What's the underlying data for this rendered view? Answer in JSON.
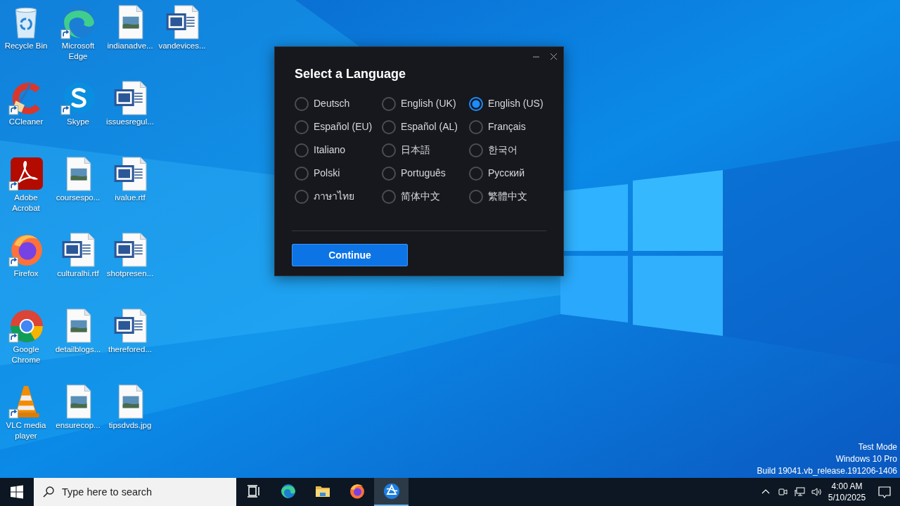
{
  "desktop": {
    "icons": [
      {
        "label": "Recycle Bin",
        "kind": "recycle-bin",
        "shortcut": false
      },
      {
        "label": "CCleaner",
        "kind": "ccleaner",
        "shortcut": true
      },
      {
        "label": "Adobe Acrobat",
        "kind": "acrobat",
        "shortcut": true
      },
      {
        "label": "Firefox",
        "kind": "firefox",
        "shortcut": true
      },
      {
        "label": "Google Chrome",
        "kind": "chrome",
        "shortcut": true
      },
      {
        "label": "VLC media player",
        "kind": "vlc",
        "shortcut": true
      },
      {
        "label": "Microsoft Edge",
        "kind": "edge",
        "shortcut": true
      },
      {
        "label": "Skype",
        "kind": "skype",
        "shortcut": true
      },
      {
        "label": "coursespo...",
        "kind": "image-file",
        "shortcut": false
      },
      {
        "label": "culturalhi.rtf",
        "kind": "word-file",
        "shortcut": false
      },
      {
        "label": "detailblogs...",
        "kind": "image-file",
        "shortcut": false
      },
      {
        "label": "ensurecop...",
        "kind": "image-file",
        "shortcut": false
      },
      {
        "label": "indianadve...",
        "kind": "image-file",
        "shortcut": false
      },
      {
        "label": "issuesregul...",
        "kind": "word-file",
        "shortcut": false
      },
      {
        "label": "ivalue.rtf",
        "kind": "word-file",
        "shortcut": false
      },
      {
        "label": "shotpresen...",
        "kind": "word-file",
        "shortcut": false
      },
      {
        "label": "therefored...",
        "kind": "word-file",
        "shortcut": false
      },
      {
        "label": "tipsdvds.jpg",
        "kind": "image-file",
        "shortcut": false
      },
      {
        "label": "vandevices...",
        "kind": "word-file",
        "shortcut": false
      }
    ],
    "system_notice": [
      "Test Mode",
      "Windows 10 Pro",
      "Build 19041.vb_release.191206-1406"
    ]
  },
  "dialog": {
    "title": "Select a Language",
    "languages": [
      {
        "label": "Deutsch",
        "selected": false
      },
      {
        "label": "English (UK)",
        "selected": false
      },
      {
        "label": "English (US)",
        "selected": true
      },
      {
        "label": "Español (EU)",
        "selected": false
      },
      {
        "label": "Español (AL)",
        "selected": false
      },
      {
        "label": "Français",
        "selected": false
      },
      {
        "label": "Italiano",
        "selected": false
      },
      {
        "label": "日本語",
        "selected": false
      },
      {
        "label": "한국어",
        "selected": false
      },
      {
        "label": "Polski",
        "selected": false
      },
      {
        "label": "Português",
        "selected": false
      },
      {
        "label": "Русский",
        "selected": false
      },
      {
        "label": "ภาษาไทย",
        "selected": false
      },
      {
        "label": "简体中文",
        "selected": false
      },
      {
        "label": "繁體中文",
        "selected": false
      }
    ],
    "button": "Continue"
  },
  "taskbar": {
    "search": {
      "placeholder": "Type here to search"
    },
    "apps": [
      {
        "kind": "task-view",
        "active": false
      },
      {
        "kind": "edge",
        "active": false
      },
      {
        "kind": "folder",
        "active": false
      },
      {
        "kind": "firefox",
        "active": false
      },
      {
        "kind": "installer",
        "active": true
      }
    ],
    "clock": {
      "time": "4:00 AM",
      "date": "5/10/2025"
    }
  }
}
